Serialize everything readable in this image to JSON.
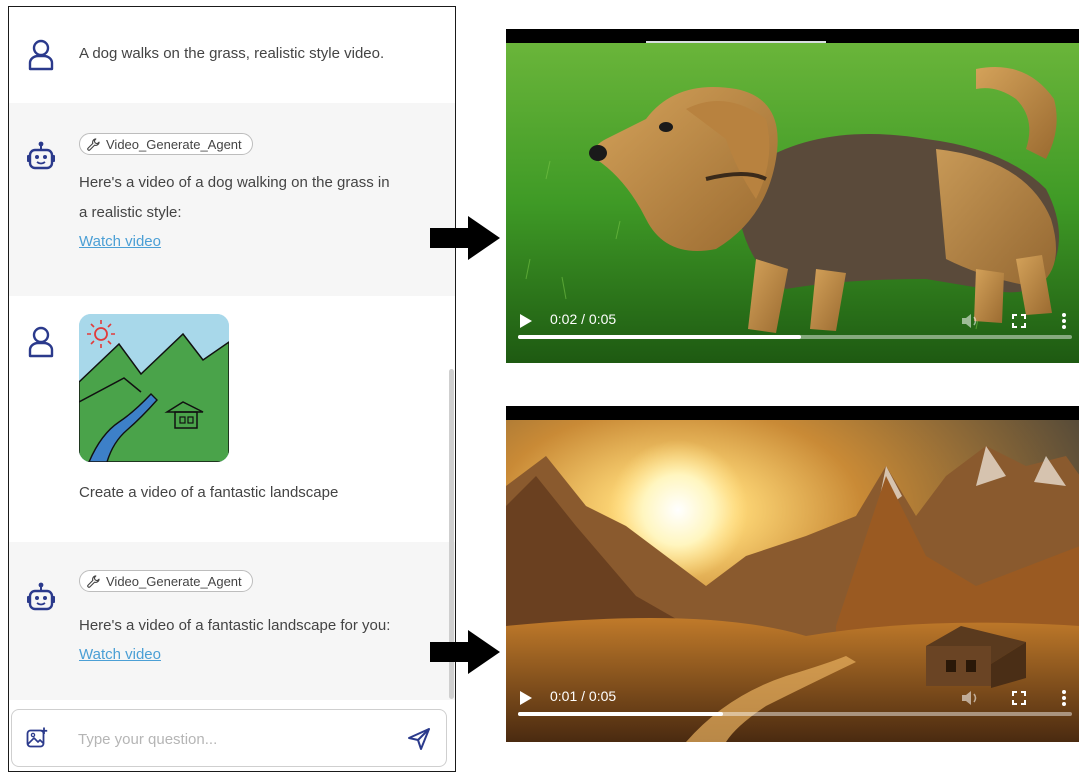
{
  "chat": {
    "messages": [
      {
        "role": "user",
        "text": "A dog walks on the grass, realistic style video."
      },
      {
        "role": "bot",
        "tool": "Video_Generate_Agent",
        "text_lines": [
          "Here's a video of a dog walking on the grass in",
          "a realistic style:"
        ],
        "link": "Watch video"
      },
      {
        "role": "user",
        "text": "Create a video of a fantastic landscape"
      },
      {
        "role": "bot",
        "tool": "Video_Generate_Agent",
        "text_lines": [
          "Here's a video of a fantastic landscape for you:"
        ],
        "link": "Watch video"
      }
    ],
    "input": {
      "placeholder": "Type your question..."
    },
    "icons": {
      "user": "user-avatar-icon",
      "bot": "robot-avatar-icon",
      "tool": "wrench-icon",
      "attach": "image-upload-icon",
      "send": "send-icon"
    }
  },
  "videos": [
    {
      "time": "0:02 / 0:05",
      "progress": 0.51
    },
    {
      "time": "0:01 / 0:05",
      "progress": 0.37
    }
  ],
  "colors": {
    "link": "#4b9fd5",
    "avatar": "#2b3a8c",
    "bot_bg": "#f6f6f6"
  }
}
